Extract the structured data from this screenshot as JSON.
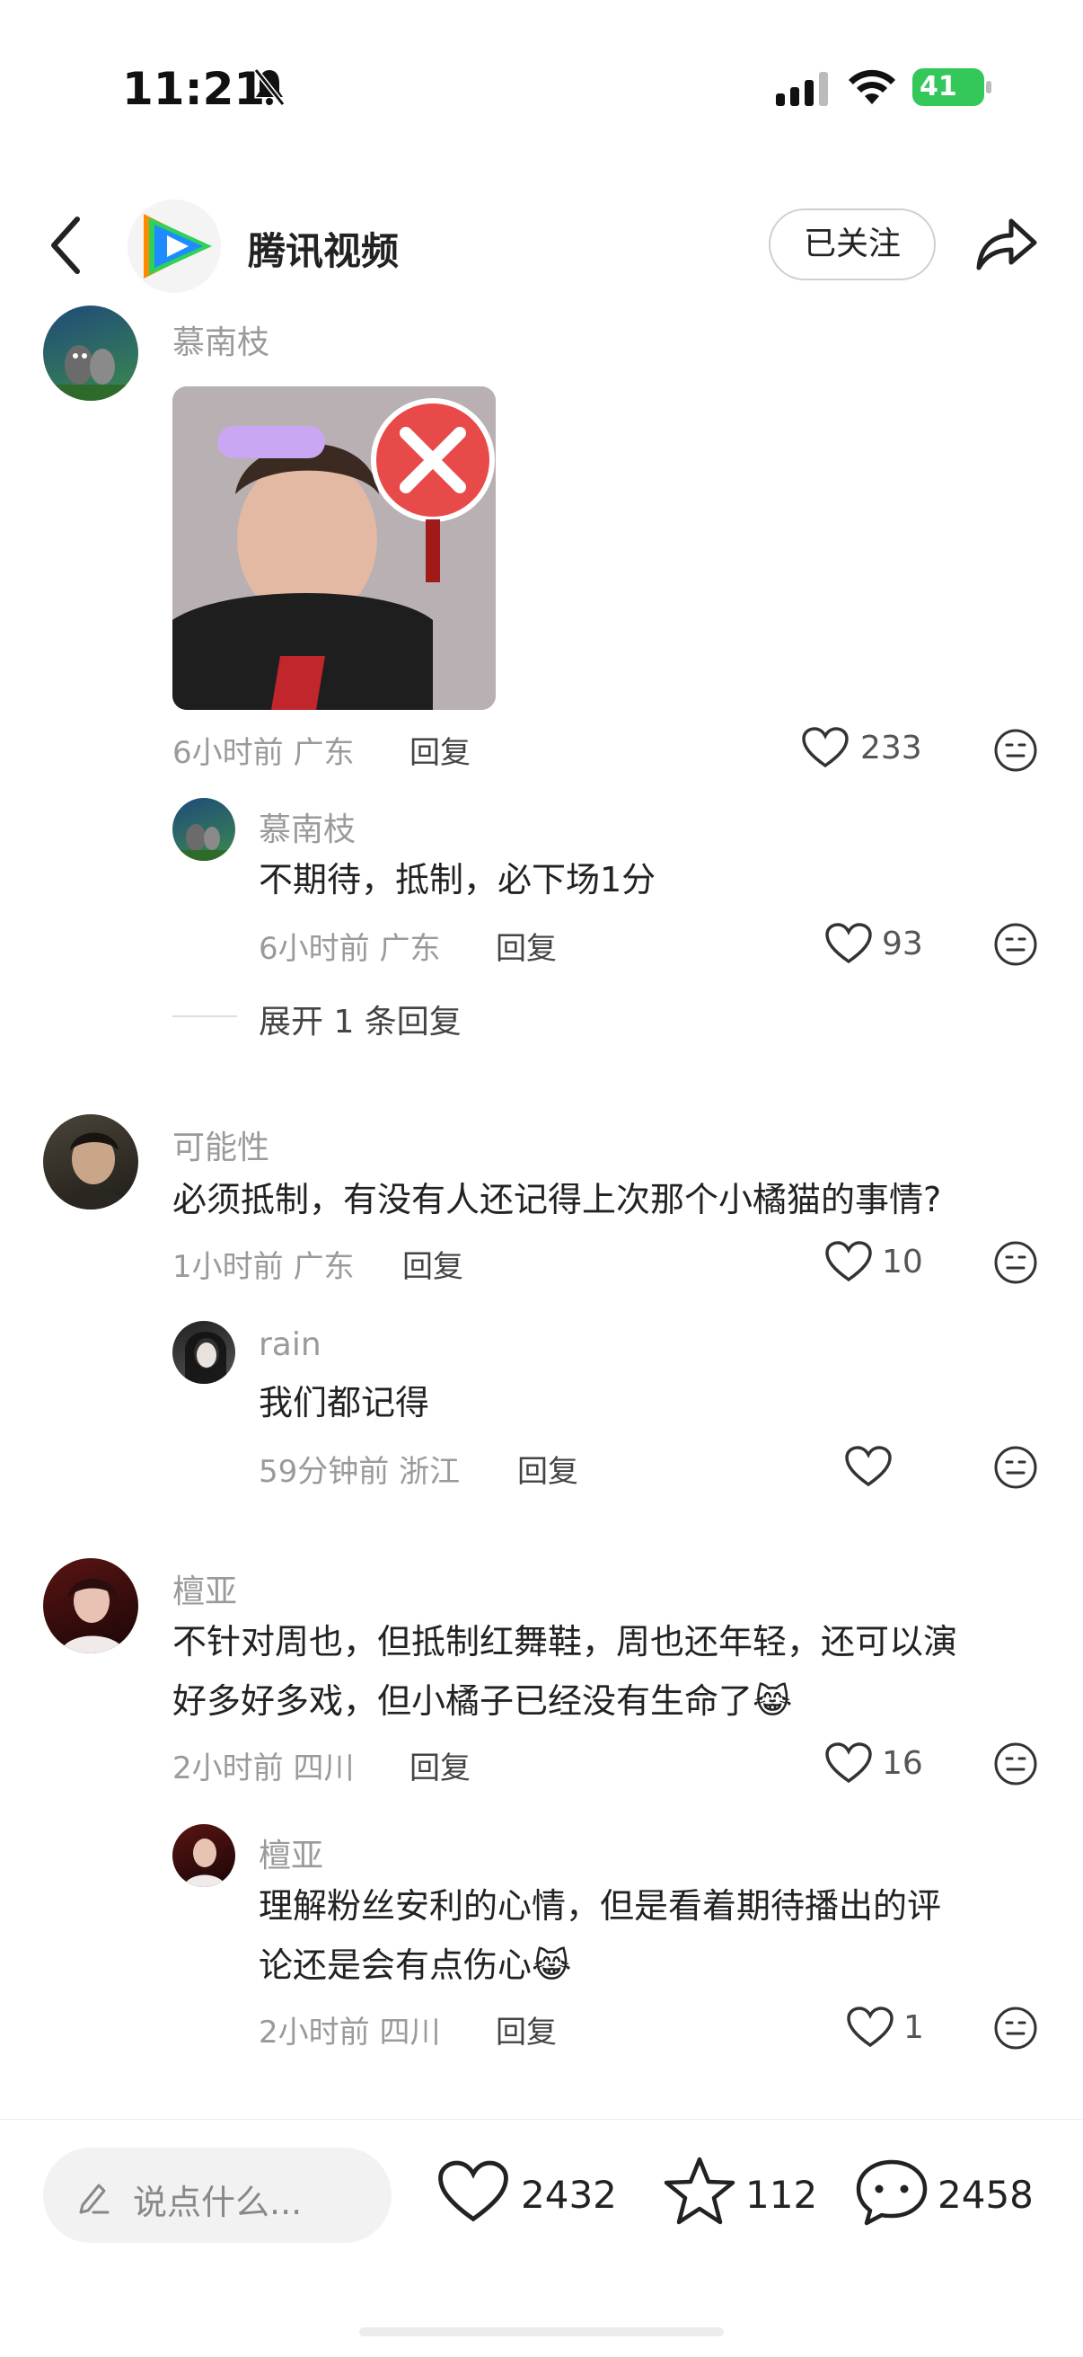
{
  "status_bar": {
    "time": "11:21",
    "battery": "41"
  },
  "header": {
    "app_name": "腾讯视频",
    "follow_label": "已关注"
  },
  "comments": [
    {
      "name": "慕南枝",
      "meta": "6小时前 广东",
      "reply_label": "回复",
      "likes": "233",
      "replies": [
        {
          "name": "慕南枝",
          "text": "不期待，抵制，必下场1分",
          "meta": "6小时前 广东",
          "reply_label": "回复",
          "likes": "93"
        }
      ],
      "expand_label": "展开 1 条回复"
    },
    {
      "name": "可能性",
      "text": "必须抵制，有没有人还记得上次那个小橘猫的事情?",
      "meta": "1小时前 广东",
      "reply_label": "回复",
      "likes": "10",
      "replies": [
        {
          "name": "rain",
          "text": "我们都记得",
          "meta": "59分钟前 浙江",
          "reply_label": "回复",
          "likes": ""
        }
      ]
    },
    {
      "name": "檀亚",
      "text_line1": "不针对周也，但抵制红舞鞋，周也还年轻，还可以演",
      "text_line2": "好多好多戏，但小橘子已经没有生命了😹",
      "meta": "2小时前 四川",
      "reply_label": "回复",
      "likes": "16",
      "replies": [
        {
          "name": "檀亚",
          "text_line1": "理解粉丝安利的心情，但是看着期待播出的评",
          "text_line2": "论还是会有点伤心😹",
          "meta": "2小时前 四川",
          "reply_label": "回复",
          "likes": "1"
        }
      ]
    }
  ],
  "bottom_bar": {
    "input_placeholder": "说点什么...",
    "like_count": "2432",
    "favorite_count": "112",
    "comment_count": "2458"
  },
  "colors": {
    "accent_green": "#34c759",
    "tencent_blue": "#1e8bff",
    "tencent_orange": "#ff8a00",
    "tencent_green": "#2fd158"
  }
}
